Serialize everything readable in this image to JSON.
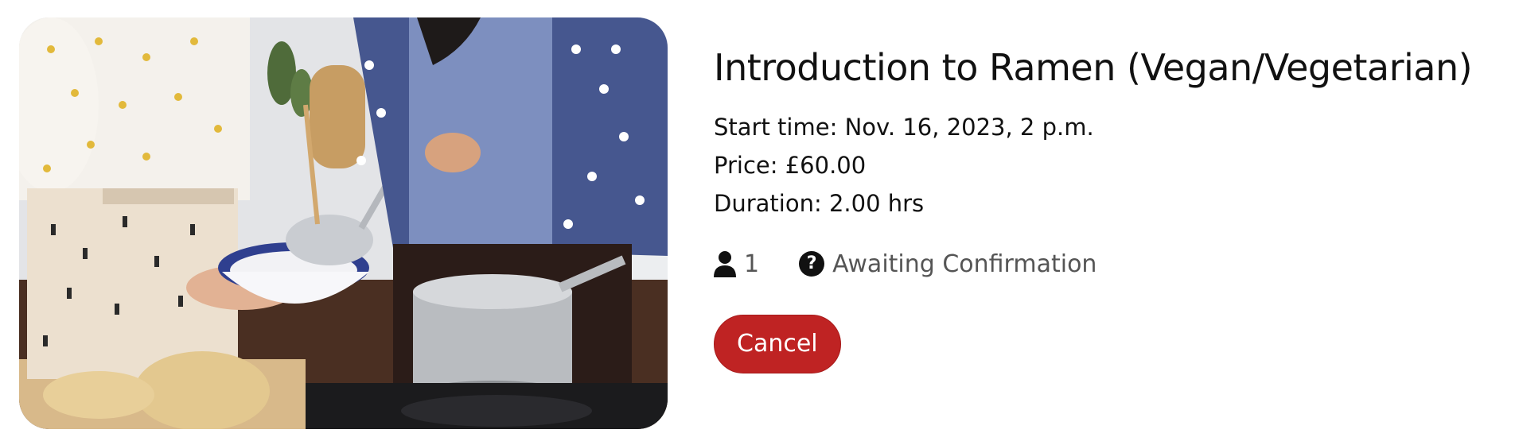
{
  "class": {
    "title": "Introduction to Ramen (Vegan/Vegetarian)",
    "start_time": "Start time: Nov. 16, 2023, 2 p.m.",
    "price": "Price: £60.00",
    "duration": "Duration: 2.00 hrs"
  },
  "booking": {
    "attendees": "1",
    "status": "Awaiting Confirmation",
    "person_icon": "person-icon",
    "status_icon": "question-circle-icon"
  },
  "actions": {
    "cancel_label": "Cancel"
  },
  "colors": {
    "cancel_button": "#bf2323",
    "status_text": "#555555",
    "title_text": "#111111"
  }
}
